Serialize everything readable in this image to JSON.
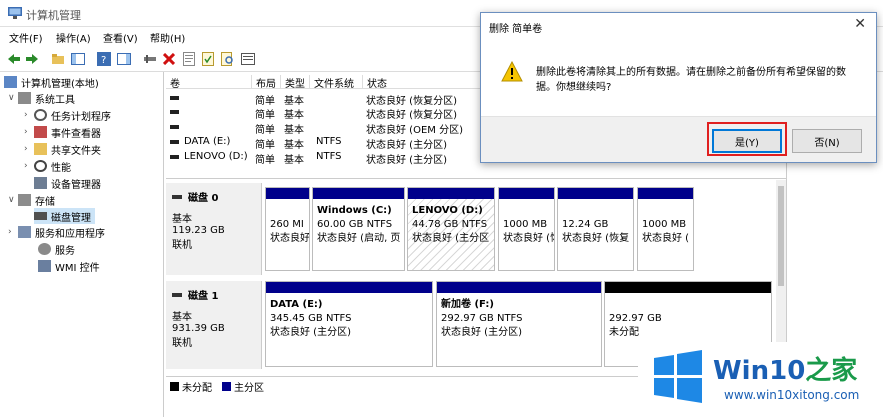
{
  "window": {
    "title": "计算机管理"
  },
  "menu": [
    "文件(F)",
    "操作(A)",
    "查看(V)",
    "帮助(H)"
  ],
  "tree": {
    "root": "计算机管理(本地)",
    "system_tools": "系统工具",
    "task_scheduler": "任务计划程序",
    "event_viewer": "事件查看器",
    "shared_folders": "共享文件夹",
    "performance": "性能",
    "device_manager": "设备管理器",
    "storage": "存储",
    "disk_management": "磁盘管理",
    "services_apps": "服务和应用程序",
    "services": "服务",
    "wmi": "WMI 控件"
  },
  "volume_table": {
    "headers": [
      "卷",
      "布局",
      "类型",
      "文件系统",
      "状态"
    ],
    "rows": [
      {
        "vol": "",
        "layout": "简单",
        "type": "基本",
        "fs": "",
        "status": "状态良好 (恢复分区)"
      },
      {
        "vol": "",
        "layout": "简单",
        "type": "基本",
        "fs": "",
        "status": "状态良好 (恢复分区)"
      },
      {
        "vol": "",
        "layout": "简单",
        "type": "基本",
        "fs": "",
        "status": "状态良好 (OEM 分区)"
      },
      {
        "vol": "DATA (E:)",
        "layout": "简单",
        "type": "基本",
        "fs": "NTFS",
        "status": "状态良好 (主分区)"
      },
      {
        "vol": "LENOVO (D:)",
        "layout": "简单",
        "type": "基本",
        "fs": "NTFS",
        "status": "状态良好 (主分区)"
      }
    ]
  },
  "disks": [
    {
      "name": "磁盘 0",
      "kind": "基本",
      "size": "119.23 GB",
      "state": "联机",
      "partitions": [
        {
          "title": "",
          "size": "260 MI",
          "status": "状态良好"
        },
        {
          "title": "Windows  (C:)",
          "size": "60.00 GB NTFS",
          "status": "状态良好 (启动, 页"
        },
        {
          "title": "LENOVO  (D:)",
          "size": "44.78 GB NTFS",
          "status": "状态良好 (主分区"
        },
        {
          "title": "",
          "size": "1000 MB",
          "status": "状态良好 (恢"
        },
        {
          "title": "",
          "size": "12.24 GB",
          "status": "状态良好 (恢复"
        },
        {
          "title": "",
          "size": "1000 MB",
          "status": "状态良好 ("
        }
      ]
    },
    {
      "name": "磁盘 1",
      "kind": "基本",
      "size": "931.39 GB",
      "state": "联机",
      "partitions": [
        {
          "title": "DATA  (E:)",
          "size": "345.45 GB NTFS",
          "status": "状态良好 (主分区)"
        },
        {
          "title": "新加卷  (F:)",
          "size": "292.97 GB NTFS",
          "status": "状态良好 (主分区)"
        },
        {
          "title": "",
          "size": "292.97 GB",
          "status": "未分配"
        }
      ]
    }
  ],
  "legend": {
    "unallocated": "未分配",
    "primary": "主分区"
  },
  "dialog": {
    "title": "删除 简单卷",
    "message": "删除此卷将清除其上的所有数据。请在删除之前备份所有希望保留的数据。你想继续吗?",
    "yes": "是(Y)",
    "no": "否(N)"
  },
  "watermark": {
    "brand_a": "Win10",
    "brand_b": "之家",
    "site": "www.win10xitong.com"
  },
  "colors": {
    "primary_partition": "#00008b",
    "unallocated": "#000000",
    "accent": "#0078d7",
    "highlight": "#e02020"
  }
}
